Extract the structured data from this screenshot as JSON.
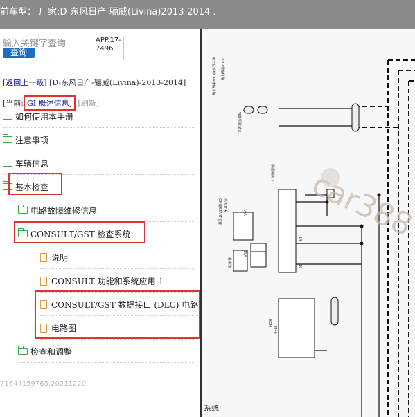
{
  "header": {
    "title": "前车型：  厂家:D-东风日产-骊威(Livina)2013-2014   ."
  },
  "search": {
    "placeholder": "输入关键字查询",
    "button_label": "查询"
  },
  "app_version": "APP.17-7496",
  "navigation": {
    "back_link": "[返回上一级]",
    "path": "[D-东风日产-骊威(Livina)-2013-2014]",
    "current_prefix": "[当前:",
    "current_value": "GI 概述信息]",
    "refresh": "[刷新]"
  },
  "tree": [
    {
      "label": "如何使用本手册",
      "type": "folder"
    },
    {
      "label": "注意事项",
      "type": "folder"
    },
    {
      "label": "车辆信息",
      "type": "folder"
    },
    {
      "label": "基本检查",
      "type": "folder-open"
    },
    {
      "label": "电路故障维修信息",
      "type": "folder"
    },
    {
      "label": "CONSULT/GST 检查系统",
      "type": "folder-open"
    },
    {
      "label": "说明",
      "type": "document"
    },
    {
      "label": "CONSULT 功能和系统应用 1",
      "type": "document"
    },
    {
      "label": "CONSULT/GST 数据接口 (DLC) 电路",
      "type": "document"
    },
    {
      "label": "电路图",
      "type": "document"
    },
    {
      "label": "检查和调整",
      "type": "folder"
    }
  ],
  "footer_id": "71644159765.20211220",
  "diagram": {
    "watermark": "car388",
    "side_label": "系统",
    "labels": {
      "l1": "用于在诊断CAN通信线路",
      "l2": "DDL2通信线路",
      "l3": "带CVT",
      "l4": "智能钥匙单元",
      "l5": "数据链接口",
      "l6": "点火开关",
      "l7": "ON或START位置",
      "l8": "蓄电池",
      "l9": "ECM",
      "l10": "10A",
      "l11": "15A",
      "l12": "M44",
      "l13": "M22",
      "l14": "M24",
      "l15": "14",
      "l16": "16",
      "l17": "M46",
      "l18": "M45"
    }
  },
  "colors": {
    "topbar": "#8a8a8a",
    "highlight": "#dd3333",
    "button": "#1a6fc2",
    "folder": "#3aaa3a",
    "document": "#e0a040"
  }
}
